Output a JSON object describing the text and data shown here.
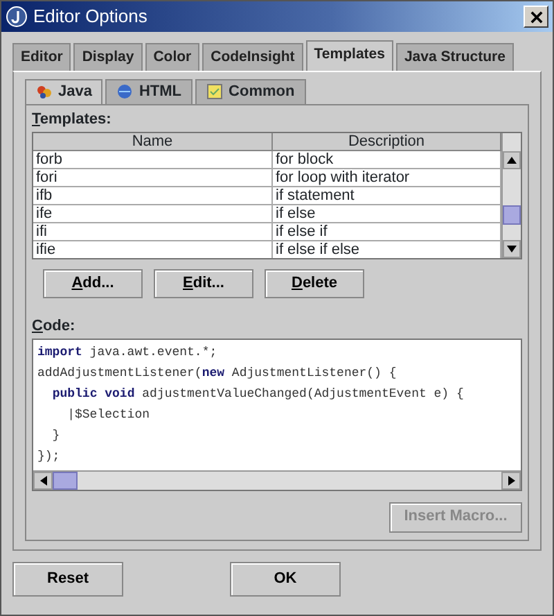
{
  "window": {
    "title": "Editor Options"
  },
  "tabs": [
    {
      "label": "Editor",
      "selected": false
    },
    {
      "label": "Display",
      "selected": false
    },
    {
      "label": "Color",
      "selected": false
    },
    {
      "label": "CodeInsight",
      "selected": false
    },
    {
      "label": "Templates",
      "selected": true
    },
    {
      "label": "Java Structure",
      "selected": false
    }
  ],
  "subtabs": [
    {
      "label": "Java",
      "selected": true,
      "kind": "java"
    },
    {
      "label": "HTML",
      "selected": false,
      "kind": "html"
    },
    {
      "label": "Common",
      "selected": false,
      "kind": "common"
    }
  ],
  "templates_label": "Templates:",
  "table": {
    "columns": [
      "Name",
      "Description"
    ],
    "rows": [
      {
        "cells": [
          "forb",
          "for block"
        ]
      },
      {
        "cells": [
          "fori",
          "for loop with iterator"
        ]
      },
      {
        "cells": [
          "ifb",
          "if statement"
        ]
      },
      {
        "cells": [
          "ife",
          "if else"
        ]
      },
      {
        "cells": [
          "ifi",
          "if else if"
        ]
      },
      {
        "cells": [
          "ifie",
          "if else if else"
        ]
      }
    ]
  },
  "table_buttons": [
    "Add...",
    "Edit...",
    "Delete"
  ],
  "code_label": "Code:",
  "code_lines": [
    "**import** java.awt.event.*;",
    "addAdjustmentListener(**new** AdjustmentListener() {",
    "  **public** **void** adjustmentValueChanged(AdjustmentEvent e) {",
    "    |$Selection",
    "  }",
    "});"
  ],
  "insert_macro": {
    "label": "Insert Macro...",
    "disabled": true
  },
  "footer_buttons": [
    {
      "label": "Reset"
    },
    {
      "label": "OK"
    }
  ]
}
